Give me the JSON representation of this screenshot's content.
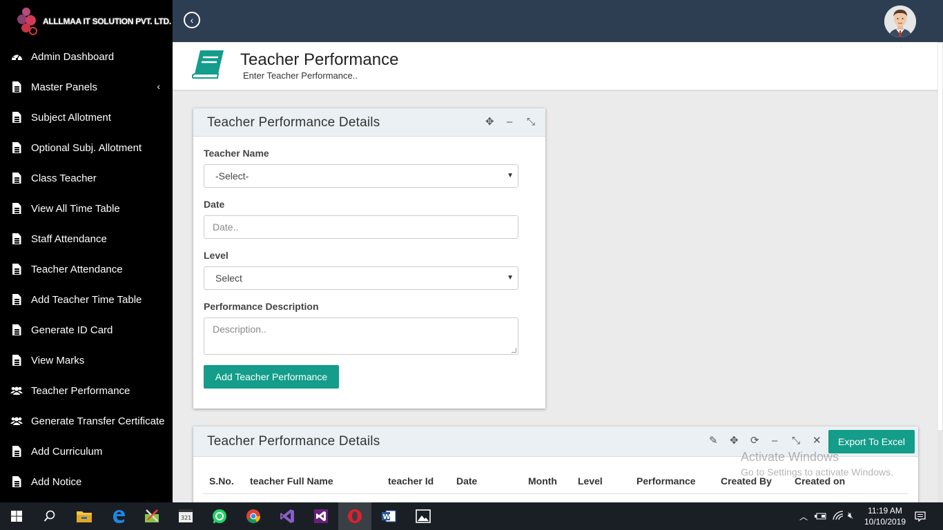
{
  "brand": {
    "name": "ALLLMAA IT SOLUTION PVT. LTD."
  },
  "sidebar": {
    "items": [
      {
        "label": "Admin Dashboard",
        "icon": "dashboard-icon"
      },
      {
        "label": "Master Panels",
        "icon": "file-icon",
        "chevron": "‹"
      },
      {
        "label": "Subject Allotment",
        "icon": "file-icon"
      },
      {
        "label": "Optional Subj. Allotment",
        "icon": "file-icon"
      },
      {
        "label": "Class Teacher",
        "icon": "file-icon"
      },
      {
        "label": "View All Time Table",
        "icon": "file-icon"
      },
      {
        "label": "Staff Attendance",
        "icon": "file-icon"
      },
      {
        "label": "Teacher Attendance",
        "icon": "file-icon"
      },
      {
        "label": "Add Teacher Time Table",
        "icon": "file-icon"
      },
      {
        "label": "Generate ID Card",
        "icon": "file-icon"
      },
      {
        "label": "View Marks",
        "icon": "file-icon"
      },
      {
        "label": "Teacher Performance",
        "icon": "users-icon"
      },
      {
        "label": "Generate Transfer Certificate",
        "icon": "users-icon"
      },
      {
        "label": "Add Curriculum",
        "icon": "file-icon"
      },
      {
        "label": "Add Notice",
        "icon": "file-icon"
      }
    ]
  },
  "header": {
    "title": "Teacher Performance",
    "subtitle": "Enter Teacher Performance..",
    "icon": "book-icon",
    "accent": "#139d8a"
  },
  "form_panel": {
    "title": "Teacher Performance Details",
    "teacher_name_label": "Teacher Name",
    "teacher_name_value": "-Select-",
    "date_label": "Date",
    "date_placeholder": "Date..",
    "level_label": "Level",
    "level_value": "Select",
    "description_label": "Performance Description",
    "description_placeholder": "Description..",
    "submit_label": "Add Teacher Performance"
  },
  "table_panel": {
    "title": "Teacher Performance Details",
    "export_label": "Export To Excel",
    "columns": [
      "S.No.",
      "teacher Full Name",
      "teacher Id",
      "Date",
      "Month",
      "Level",
      "Performance",
      "Created By",
      "Created on"
    ]
  },
  "watermark": {
    "line1": "Activate Windows",
    "line2": "Go to Settings to activate Windows."
  },
  "taskbar": {
    "apps": [
      "start-icon",
      "search-icon",
      "file-explorer-icon",
      "edge-icon",
      "tools-icon",
      "video-editor-icon",
      "whatsapp-icon",
      "chrome-icon",
      "visual-studio-icon",
      "visual-studio-preview-icon",
      "opera-icon",
      "word-icon",
      "photos-icon"
    ],
    "time": "11:19 AM",
    "date": "10/10/2019"
  }
}
